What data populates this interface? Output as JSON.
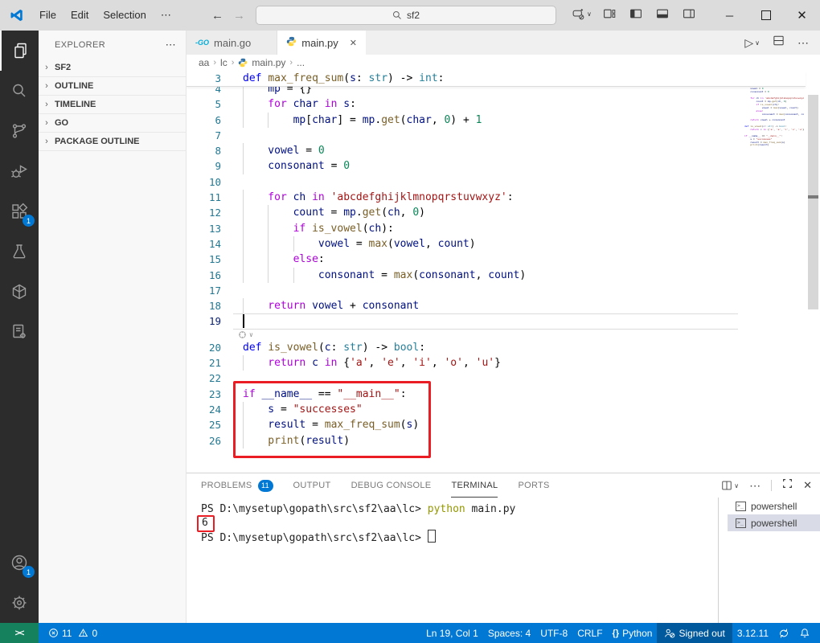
{
  "title_bar": {
    "menus": [
      "File",
      "Edit",
      "Selection",
      "⋯"
    ],
    "search_value": "sf2"
  },
  "activity_bar": {
    "items": [
      {
        "name": "explorer",
        "active": true
      },
      {
        "name": "search"
      },
      {
        "name": "source-control"
      },
      {
        "name": "run-debug"
      },
      {
        "name": "extensions",
        "badge": "1"
      },
      {
        "name": "testing"
      },
      {
        "name": "aws-toolkit"
      },
      {
        "name": "file-settings"
      }
    ],
    "bottom": [
      {
        "name": "accounts",
        "badge": "1"
      },
      {
        "name": "settings"
      }
    ]
  },
  "sidebar": {
    "title": "EXPLORER",
    "sections": [
      "SF2",
      "OUTLINE",
      "TIMELINE",
      "GO",
      "PACKAGE OUTLINE"
    ]
  },
  "tabs": [
    {
      "label": "main.go",
      "icon_text": "GO"
    },
    {
      "label": "main.py",
      "active": true,
      "close": "✕"
    }
  ],
  "breadcrumb": {
    "seg0": "aa",
    "seg1": "lc",
    "seg2": "main.py",
    "seg3": "..."
  },
  "editor": {
    "lines": [
      {
        "n": 3,
        "sticky": true,
        "i": 0,
        "t": [
          [
            "b",
            "def"
          ],
          [
            "p",
            " "
          ],
          [
            "f",
            "max_freq_sum"
          ],
          [
            "p",
            "("
          ],
          [
            "v",
            "s"
          ],
          [
            "p",
            ": "
          ],
          [
            "t",
            "str"
          ],
          [
            "p",
            ") -> "
          ],
          [
            "t",
            "int"
          ],
          [
            "p",
            ":"
          ]
        ]
      },
      {
        "n": 4,
        "clip": true,
        "i": 1,
        "t": [
          [
            "v",
            "mp"
          ],
          [
            "p",
            " = {}"
          ]
        ]
      },
      {
        "n": 5,
        "i": 1,
        "t": [
          [
            "k",
            "for"
          ],
          [
            "p",
            " "
          ],
          [
            "v",
            "char"
          ],
          [
            "p",
            " "
          ],
          [
            "k",
            "in"
          ],
          [
            "p",
            " "
          ],
          [
            "v",
            "s"
          ],
          [
            "p",
            ":"
          ]
        ]
      },
      {
        "n": 6,
        "i": 2,
        "t": [
          [
            "v",
            "mp"
          ],
          [
            "p",
            "["
          ],
          [
            "v",
            "char"
          ],
          [
            "p",
            "] = "
          ],
          [
            "v",
            "mp"
          ],
          [
            "p",
            "."
          ],
          [
            "f",
            "get"
          ],
          [
            "p",
            "("
          ],
          [
            "v",
            "char"
          ],
          [
            "p",
            ", "
          ],
          [
            "n",
            "0"
          ],
          [
            "p",
            ") + "
          ],
          [
            "n",
            "1"
          ]
        ]
      },
      {
        "n": 7,
        "i": 0,
        "t": []
      },
      {
        "n": 8,
        "i": 1,
        "t": [
          [
            "v",
            "vowel"
          ],
          [
            "p",
            " = "
          ],
          [
            "n",
            "0"
          ]
        ]
      },
      {
        "n": 9,
        "i": 1,
        "t": [
          [
            "v",
            "consonant"
          ],
          [
            "p",
            " = "
          ],
          [
            "n",
            "0"
          ]
        ]
      },
      {
        "n": 10,
        "i": 0,
        "t": []
      },
      {
        "n": 11,
        "i": 1,
        "t": [
          [
            "k",
            "for"
          ],
          [
            "p",
            " "
          ],
          [
            "v",
            "ch"
          ],
          [
            "p",
            " "
          ],
          [
            "k",
            "in"
          ],
          [
            "p",
            " "
          ],
          [
            "s",
            "'abcdefghijklmnopqrstuvwxyz'"
          ],
          [
            "p",
            ":"
          ]
        ]
      },
      {
        "n": 12,
        "i": 2,
        "t": [
          [
            "v",
            "count"
          ],
          [
            "p",
            " = "
          ],
          [
            "v",
            "mp"
          ],
          [
            "p",
            "."
          ],
          [
            "f",
            "get"
          ],
          [
            "p",
            "("
          ],
          [
            "v",
            "ch"
          ],
          [
            "p",
            ", "
          ],
          [
            "n",
            "0"
          ],
          [
            "p",
            ")"
          ]
        ]
      },
      {
        "n": 13,
        "i": 2,
        "t": [
          [
            "k",
            "if"
          ],
          [
            "p",
            " "
          ],
          [
            "f",
            "is_vowel"
          ],
          [
            "p",
            "("
          ],
          [
            "v",
            "ch"
          ],
          [
            "p",
            "):"
          ]
        ]
      },
      {
        "n": 14,
        "i": 3,
        "t": [
          [
            "v",
            "vowel"
          ],
          [
            "p",
            " = "
          ],
          [
            "f",
            "max"
          ],
          [
            "p",
            "("
          ],
          [
            "v",
            "vowel"
          ],
          [
            "p",
            ", "
          ],
          [
            "v",
            "count"
          ],
          [
            "p",
            ")"
          ]
        ]
      },
      {
        "n": 15,
        "i": 2,
        "t": [
          [
            "k",
            "else"
          ],
          [
            "p",
            ":"
          ]
        ]
      },
      {
        "n": 16,
        "i": 3,
        "t": [
          [
            "v",
            "consonant"
          ],
          [
            "p",
            " = "
          ],
          [
            "f",
            "max"
          ],
          [
            "p",
            "("
          ],
          [
            "v",
            "consonant"
          ],
          [
            "p",
            ", "
          ],
          [
            "v",
            "count"
          ],
          [
            "p",
            ")"
          ]
        ]
      },
      {
        "n": 17,
        "i": 0,
        "t": []
      },
      {
        "n": 18,
        "i": 1,
        "t": [
          [
            "k",
            "return"
          ],
          [
            "p",
            " "
          ],
          [
            "v",
            "vowel"
          ],
          [
            "p",
            " + "
          ],
          [
            "v",
            "consonant"
          ]
        ]
      },
      {
        "n": 19,
        "i": 0,
        "cur": true,
        "ai": true,
        "t": []
      },
      {
        "n": 20,
        "i": 0,
        "t": [
          [
            "b",
            "def"
          ],
          [
            "p",
            " "
          ],
          [
            "f",
            "is_vowel"
          ],
          [
            "p",
            "("
          ],
          [
            "v",
            "c"
          ],
          [
            "p",
            ": "
          ],
          [
            "t",
            "str"
          ],
          [
            "p",
            ") -> "
          ],
          [
            "t",
            "bool"
          ],
          [
            "p",
            ":"
          ]
        ]
      },
      {
        "n": 21,
        "i": 1,
        "t": [
          [
            "k",
            "return"
          ],
          [
            "p",
            " "
          ],
          [
            "v",
            "c"
          ],
          [
            "p",
            " "
          ],
          [
            "k",
            "in"
          ],
          [
            "p",
            " {"
          ],
          [
            "s",
            "'a'"
          ],
          [
            "p",
            ", "
          ],
          [
            "s",
            "'e'"
          ],
          [
            "p",
            ", "
          ],
          [
            "s",
            "'i'"
          ],
          [
            "p",
            ", "
          ],
          [
            "s",
            "'o'"
          ],
          [
            "p",
            ", "
          ],
          [
            "s",
            "'u'"
          ],
          [
            "p",
            "}"
          ]
        ]
      },
      {
        "n": 22,
        "i": 0,
        "t": []
      },
      {
        "n": 23,
        "i": 0,
        "t": [
          [
            "k",
            "if"
          ],
          [
            "p",
            " "
          ],
          [
            "v",
            "__name__"
          ],
          [
            "p",
            " == "
          ],
          [
            "s",
            "\"__main__\""
          ],
          [
            "p",
            ":"
          ]
        ]
      },
      {
        "n": 24,
        "i": 1,
        "t": [
          [
            "v",
            "s"
          ],
          [
            "p",
            " = "
          ],
          [
            "s",
            "\"successes\""
          ]
        ]
      },
      {
        "n": 25,
        "i": 1,
        "t": [
          [
            "v",
            "result"
          ],
          [
            "p",
            " = "
          ],
          [
            "f",
            "max_freq_sum"
          ],
          [
            "p",
            "("
          ],
          [
            "v",
            "s"
          ],
          [
            "p",
            ")"
          ]
        ]
      },
      {
        "n": 26,
        "i": 1,
        "t": [
          [
            "f",
            "print"
          ],
          [
            "p",
            "("
          ],
          [
            "v",
            "result"
          ],
          [
            "p",
            ")"
          ]
        ]
      }
    ]
  },
  "panel": {
    "tabs": [
      {
        "label": "PROBLEMS",
        "badge": "11"
      },
      {
        "label": "OUTPUT"
      },
      {
        "label": "DEBUG CONSOLE"
      },
      {
        "label": "TERMINAL",
        "active": true
      },
      {
        "label": "PORTS"
      }
    ],
    "terminal_lines": [
      {
        "t": [
          [
            "pr",
            "PS D:\\mysetup\\gopath\\src\\sf2\\aa\\lc> "
          ],
          [
            "cmd",
            "python"
          ],
          [
            "pl",
            " main.py"
          ]
        ]
      },
      {
        "t": [
          [
            "out",
            "6"
          ]
        ],
        "box": true
      },
      {
        "t": [
          [
            "pr",
            "PS D:\\mysetup\\gopath\\src\\sf2\\aa\\lc> "
          ]
        ],
        "cursor": true
      }
    ],
    "terminal_list": [
      {
        "label": "powershell"
      },
      {
        "label": "powershell",
        "selected": true
      }
    ]
  },
  "status_bar": {
    "errors": "11",
    "warnings": "0",
    "line_col": "Ln 19, Col 1",
    "indentation": "Spaces: 4",
    "encoding": "UTF-8",
    "eol": "CRLF",
    "language": "Python",
    "account": "Signed out",
    "python_version": "3.12.11"
  },
  "colors": {
    "status_bar": "#0078d4",
    "remote": "#16825d",
    "badge": "#0078d4",
    "highlight_box": "#ea1c24",
    "keyword": "#af00db",
    "storage": "#0000ff",
    "function": "#795e26",
    "variable": "#001080",
    "type": "#267f99",
    "string": "#a31515",
    "number": "#098658"
  }
}
